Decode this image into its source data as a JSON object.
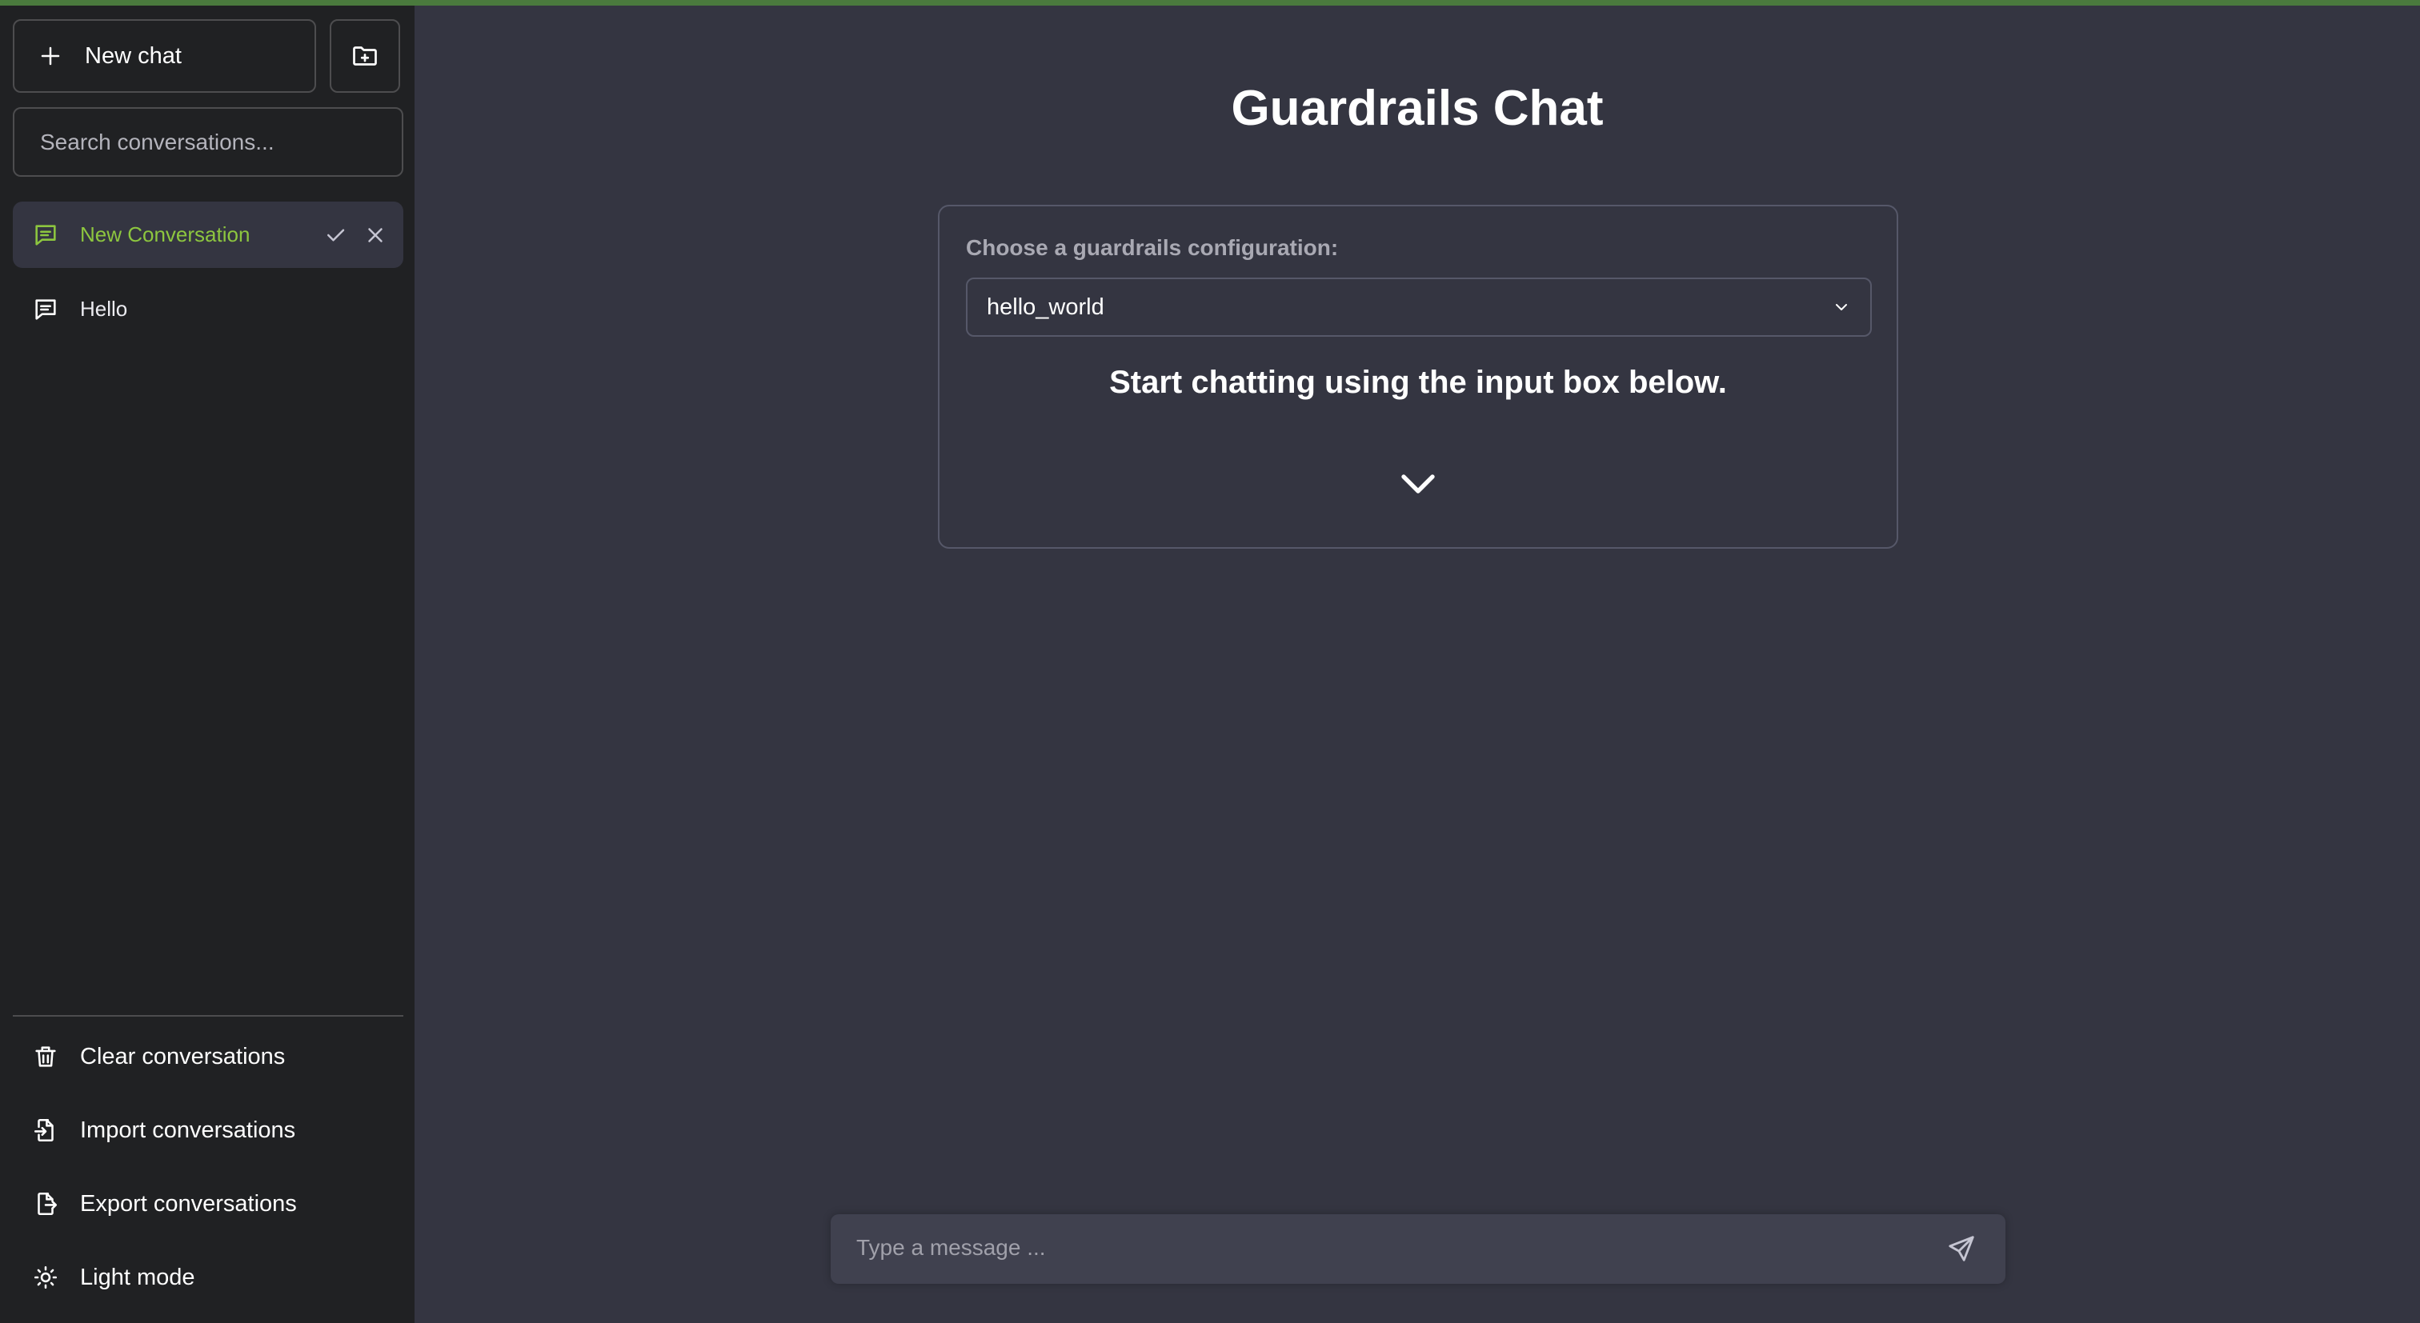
{
  "sidebar": {
    "new_chat_label": "New chat",
    "search_placeholder": "Search conversations...",
    "conversations": [
      {
        "label": "New Conversation",
        "active": true
      },
      {
        "label": "Hello",
        "active": false
      }
    ],
    "bottom_items": [
      {
        "label": "Clear conversations",
        "icon": "trash-icon"
      },
      {
        "label": "Import conversations",
        "icon": "file-import-icon"
      },
      {
        "label": "Export conversations",
        "icon": "file-export-icon"
      },
      {
        "label": "Light mode",
        "icon": "sun-icon"
      }
    ]
  },
  "main": {
    "title": "Guardrails Chat",
    "config_label": "Choose a guardrails configuration:",
    "config_selected": "hello_world",
    "hint": "Start chatting using the input box below.",
    "input_placeholder": "Type a message ..."
  },
  "colors": {
    "sidebar_bg": "#202123",
    "main_bg": "#343541",
    "accent_green": "#8dc63f",
    "top_bar": "#4a7a3d"
  }
}
